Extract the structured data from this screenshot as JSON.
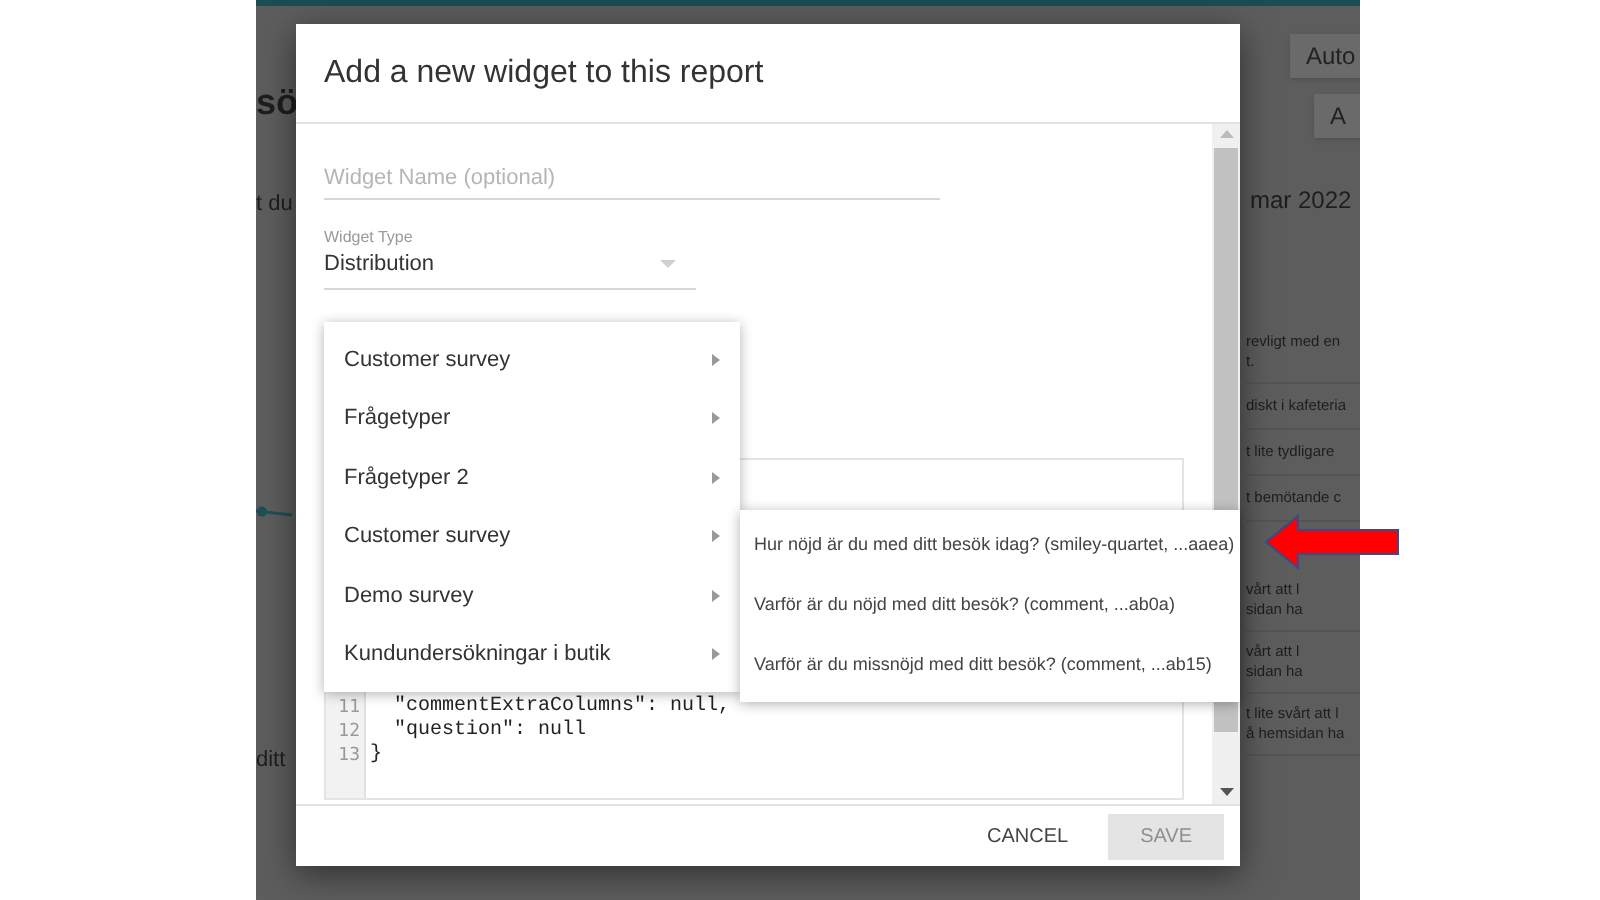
{
  "background": {
    "left_texts": [
      {
        "kind": "heading",
        "text": "sö"
      },
      {
        "kind": "label",
        "text": "t du"
      },
      {
        "kind": "chart"
      },
      {
        "kind": "label",
        "text": "ditt"
      }
    ],
    "buttons": [
      {
        "label": "Auto"
      },
      {
        "label": "A"
      }
    ],
    "date": "mar 2022",
    "comments": [
      {
        "lines": [
          "revligt med en",
          "t."
        ]
      },
      {
        "lines": [
          "diskt i kafeteria"
        ]
      },
      {
        "lines": [
          "t lite tydligare"
        ]
      },
      {
        "lines": [
          "t bemötande c"
        ]
      },
      {
        "gap_before": true,
        "lines": [
          "vårt att l",
          "sidan ha"
        ]
      },
      {
        "lines": [
          "vårt att l",
          "sidan ha"
        ]
      },
      {
        "lines": [
          "t lite svårt att l",
          "å hemsidan ha"
        ]
      }
    ]
  },
  "dialog": {
    "title": "Add a new widget to this report",
    "name_field": {
      "placeholder": "Widget Name (optional)"
    },
    "type_field": {
      "label": "Widget Type",
      "value": "Distribution"
    },
    "code_lines": [
      {
        "number": "11",
        "text": "  \"commentExtraColumns\": null,"
      },
      {
        "number": "12",
        "text": "  \"question\": null"
      },
      {
        "number": "13",
        "text": "}"
      }
    ],
    "menu": [
      {
        "label": "Customer survey"
      },
      {
        "label": "Frågetyper"
      },
      {
        "label": "Frågetyper 2"
      },
      {
        "label": "Customer survey"
      },
      {
        "label": "Demo survey"
      },
      {
        "label": "Kundundersökningar i butik"
      }
    ],
    "submenu": [
      {
        "label": "Hur nöjd är du med ditt besök idag? (smiley-quartet, ...aaea)"
      },
      {
        "label": "Varför är du nöjd med ditt besök? (comment, ...ab0a)"
      },
      {
        "label": "Varför är du missnöjd med ditt besök? (comment, ...ab15)"
      }
    ],
    "buttons": [
      {
        "label": "CANCEL",
        "disabled": false
      },
      {
        "label": "SAVE",
        "disabled": true
      }
    ]
  }
}
